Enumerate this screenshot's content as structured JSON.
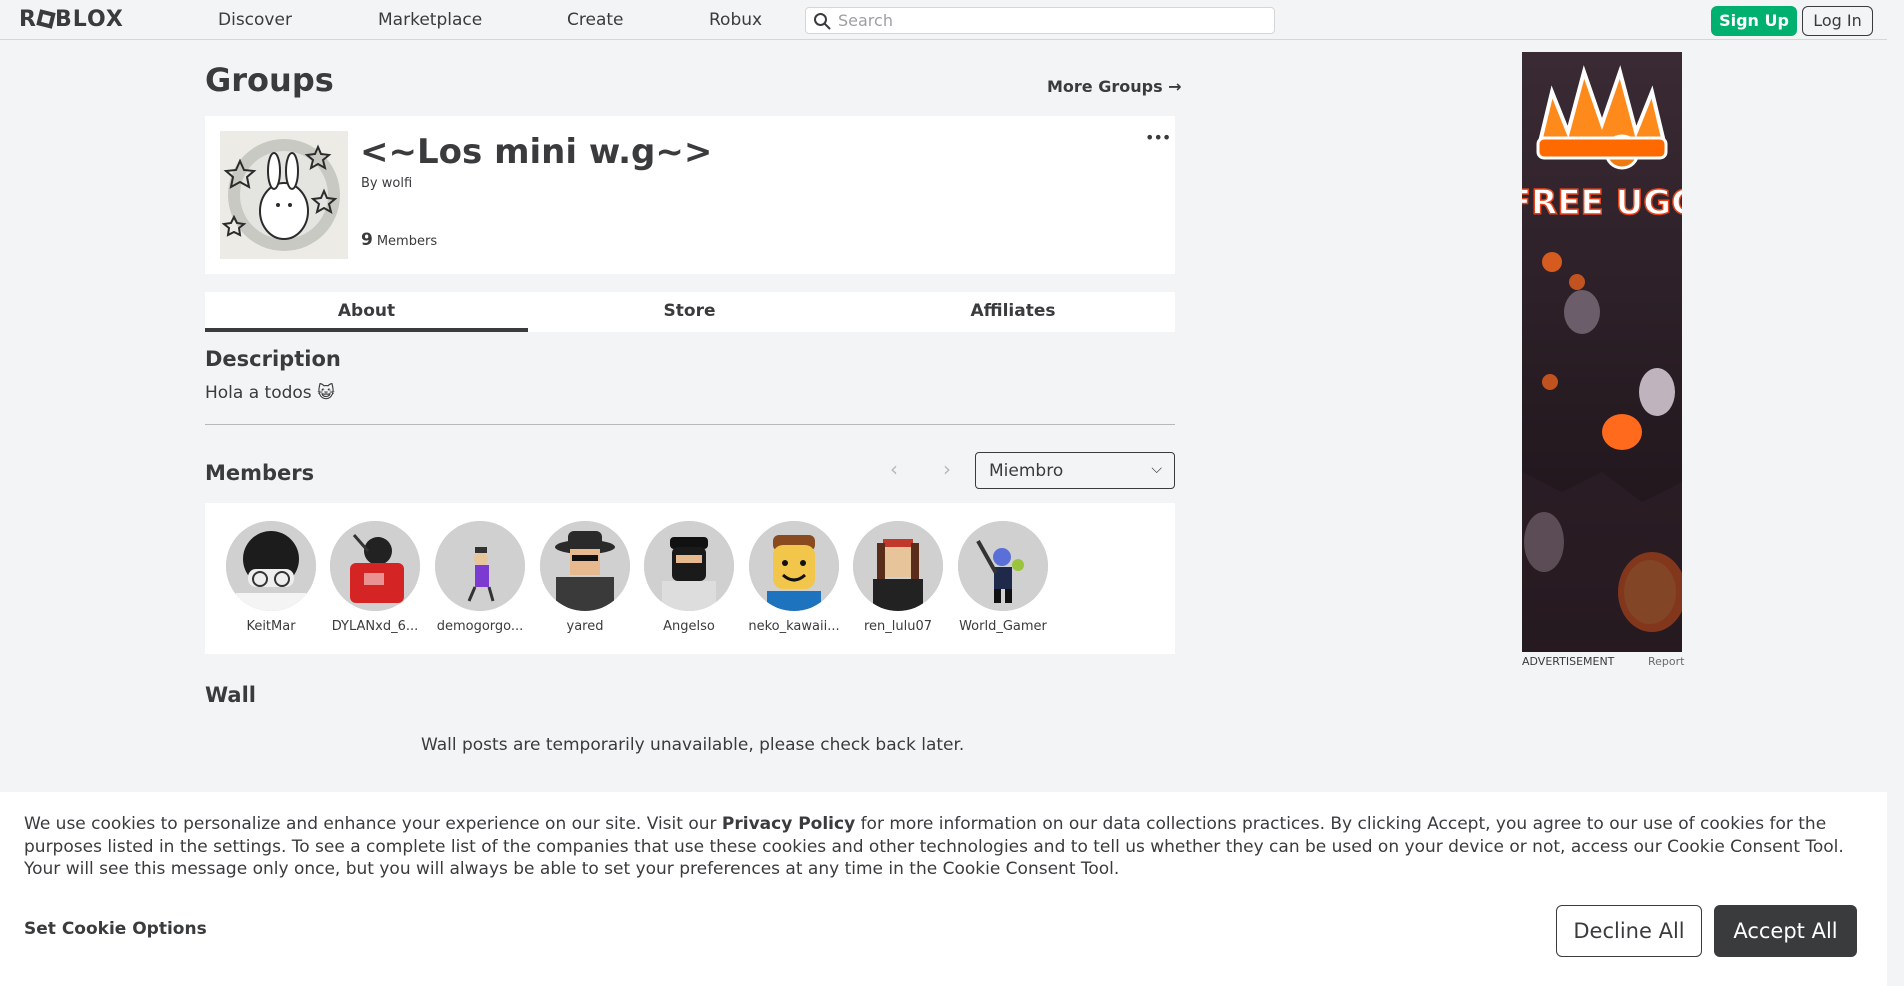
{
  "nav": {
    "logo": "ROBLOX",
    "links": [
      "Discover",
      "Marketplace",
      "Create",
      "Robux"
    ],
    "search_placeholder": "Search",
    "signup": "Sign Up",
    "login": "Log In"
  },
  "page": {
    "title": "Groups",
    "more_groups": "More Groups →"
  },
  "group": {
    "name": "<~Los mini w.g~>",
    "by_prefix": "By",
    "owner": "wolfi",
    "member_count": "9",
    "member_label": "Members",
    "more": "•••"
  },
  "tabs": [
    "About",
    "Store",
    "Affiliates"
  ],
  "description": {
    "heading": "Description",
    "text": "Hola a todos 😺"
  },
  "members": {
    "heading": "Members",
    "role": "Miembro",
    "list": [
      {
        "name": "KeitMar"
      },
      {
        "name": "DYLANxd_6..."
      },
      {
        "name": "demogorgo..."
      },
      {
        "name": "yared"
      },
      {
        "name": "Angelso"
      },
      {
        "name": "neko_kawaii..."
      },
      {
        "name": "ren_lulu07"
      },
      {
        "name": "World_Gamer"
      }
    ]
  },
  "wall": {
    "heading": "Wall",
    "message": "Wall posts are temporarily unavailable, please check back later."
  },
  "ad": {
    "headline": "FREE UGC",
    "label": "ADVERTISEMENT",
    "report": "Report"
  },
  "cookie": {
    "text_before": "We use cookies to personalize and enhance your experience on our site. Visit our ",
    "policy_link": "Privacy Policy",
    "text_after": " for more information on our data collections practices. By clicking Accept, you agree to our use of cookies for the purposes listed in the settings. To see a complete list of the companies that use these cookies and other technologies and to tell us whether they can be used on your device or not, access our Cookie Consent Tool. Your will see this message only once, but you will always be able to set your preferences at any time in the Cookie Consent Tool.",
    "options": "Set Cookie Options",
    "decline": "Decline All",
    "accept": "Accept All"
  },
  "colors": {
    "signup_green": "#00b06f",
    "text_dark": "#393b3d",
    "page_bg": "#f2f4f5"
  }
}
